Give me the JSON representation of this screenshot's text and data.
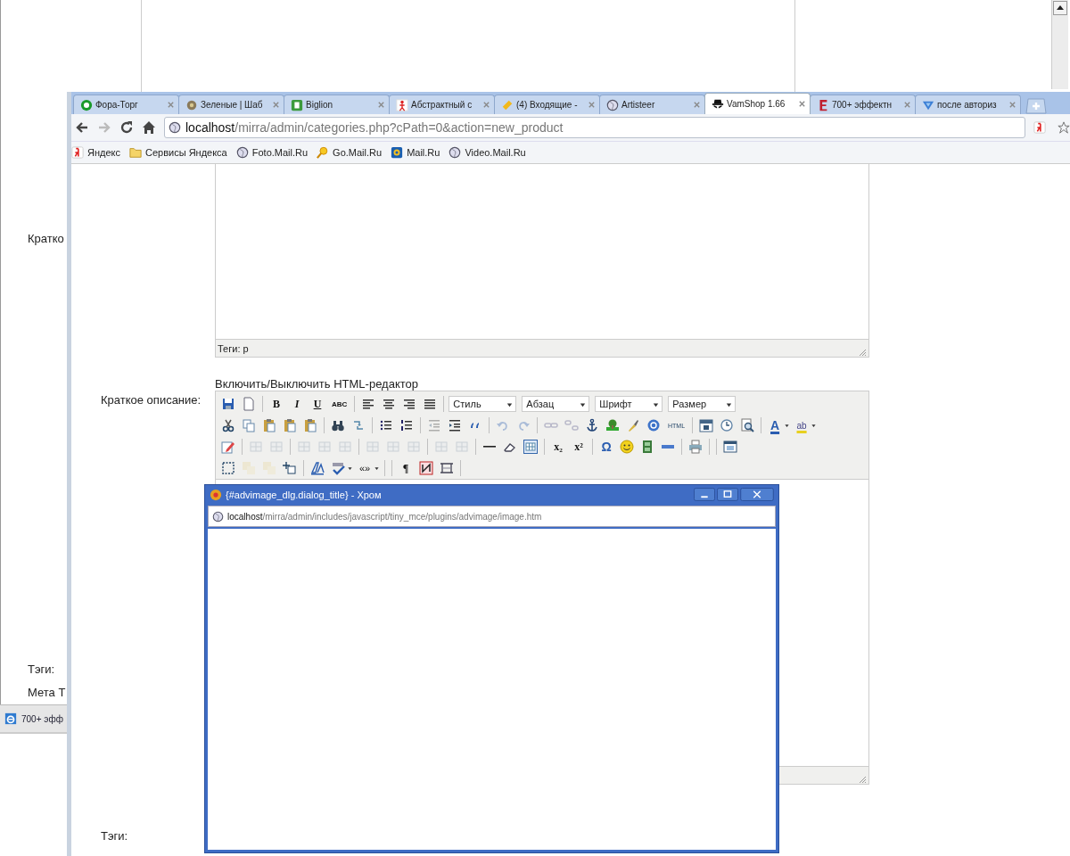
{
  "desktop_page": {
    "labels": [
      "Кратко",
      "Тэги:",
      "Мета Т"
    ]
  },
  "taskbar": {
    "items": [
      {
        "label": "700+ эфф",
        "kind": "ie"
      }
    ]
  },
  "browser": {
    "tabs": [
      {
        "label": "Фора-Торг",
        "kind": "fora",
        "selected": false
      },
      {
        "label": "Зеленые | Шаб",
        "kind": "leaf",
        "selected": false
      },
      {
        "label": "Biglion",
        "kind": "square",
        "selected": false
      },
      {
        "label": "Абстрактный с",
        "kind": "figure",
        "selected": false
      },
      {
        "label": "(4) Входящие -",
        "kind": "mail",
        "selected": false
      },
      {
        "label": "Artisteer",
        "kind": "globe",
        "selected": false
      },
      {
        "label": "VamShop 1.66",
        "kind": "hat",
        "selected": true
      },
      {
        "label": "700+ эффектн",
        "kind": "letter",
        "selected": false
      },
      {
        "label": "после авториз",
        "kind": "triangle",
        "selected": false
      }
    ],
    "address": {
      "host": "localhost",
      "path": "/mirra/admin/categories.php?cPath=0&action=new_product"
    },
    "bookmarks": [
      {
        "label": "Яндекс",
        "kind": "logo"
      },
      {
        "label": "Сервисы Яндекса",
        "kind": "folder"
      },
      {
        "label": "Foto.Mail.Ru",
        "kind": "globe"
      },
      {
        "label": "Go.Mail.Ru",
        "kind": "magnifier"
      },
      {
        "label": "Mail.Ru",
        "kind": "mail"
      },
      {
        "label": "Video.Mail.Ru",
        "kind": "globe"
      }
    ],
    "page": {
      "editor_status": "Теги: p",
      "toggle_link": "Включить/Выключить HTML-редактор",
      "field_label": "Краткое описание:",
      "tags_label": "Тэги:",
      "toolbar": [
        [
          {
            "kind": "save",
            "disabled": false
          },
          {
            "kind": "new",
            "disabled": false
          },
          {
            "kind": "sep"
          },
          {
            "kind": "bold",
            "label": "B",
            "disabled": false
          },
          {
            "kind": "italic",
            "label": "I",
            "disabled": false
          },
          {
            "kind": "underline",
            "label": "U",
            "disabled": false
          },
          {
            "kind": "strike",
            "label": "ABC",
            "disabled": false
          },
          {
            "kind": "sep"
          },
          {
            "kind": "alignleft",
            "disabled": false
          },
          {
            "kind": "aligncenter",
            "disabled": false
          },
          {
            "kind": "alignright",
            "disabled": false
          },
          {
            "kind": "justify",
            "disabled": false
          },
          {
            "kind": "sep"
          },
          {
            "kind": "select",
            "label": "Стиль"
          },
          {
            "kind": "select",
            "label": "Абзац"
          },
          {
            "kind": "select",
            "label": "Шрифт"
          },
          {
            "kind": "select",
            "label": "Размер"
          }
        ],
        [
          {
            "kind": "cut",
            "disabled": false
          },
          {
            "kind": "copy",
            "disabled": false
          },
          {
            "kind": "paste",
            "disabled": false
          },
          {
            "kind": "paste",
            "disabled": false
          },
          {
            "kind": "paste",
            "disabled": false
          },
          {
            "kind": "sep"
          },
          {
            "kind": "find",
            "disabled": false
          },
          {
            "kind": "replace",
            "disabled": false
          },
          {
            "kind": "sep"
          },
          {
            "kind": "bullist",
            "disabled": false
          },
          {
            "kind": "numlist",
            "disabled": false
          },
          {
            "kind": "sep"
          },
          {
            "kind": "outdent",
            "disabled": true
          },
          {
            "kind": "indent",
            "disabled": false
          },
          {
            "kind": "quote",
            "disabled": false
          },
          {
            "kind": "sep"
          },
          {
            "kind": "undo",
            "disabled": true
          },
          {
            "kind": "redo",
            "disabled": true
          },
          {
            "kind": "sep"
          },
          {
            "kind": "link",
            "disabled": true
          },
          {
            "kind": "unlink",
            "disabled": true
          },
          {
            "kind": "anchor",
            "disabled": false
          },
          {
            "kind": "image",
            "disabled": false
          },
          {
            "kind": "brush",
            "disabled": false
          },
          {
            "kind": "help",
            "disabled": false
          },
          {
            "kind": "html",
            "label": "HTML",
            "disabled": false
          },
          {
            "kind": "sep"
          },
          {
            "kind": "calendar",
            "disabled": false
          },
          {
            "kind": "clock",
            "disabled": false
          },
          {
            "kind": "preview",
            "disabled": false
          },
          {
            "kind": "sep"
          },
          {
            "kind": "forecolor",
            "label": "A",
            "disabled": false
          },
          {
            "kind": "caret"
          },
          {
            "kind": "backcolor",
            "label": "ab",
            "disabled": false
          },
          {
            "kind": "caret"
          }
        ],
        [
          {
            "kind": "pencil",
            "disabled": false
          },
          {
            "kind": "sep"
          },
          {
            "kind": "tableop",
            "disabled": true
          },
          {
            "kind": "tableop",
            "disabled": true
          },
          {
            "kind": "sep"
          },
          {
            "kind": "tableop",
            "disabled": true
          },
          {
            "kind": "tableop",
            "disabled": true
          },
          {
            "kind": "tableop",
            "disabled": true
          },
          {
            "kind": "sep"
          },
          {
            "kind": "tableop",
            "disabled": true
          },
          {
            "kind": "tableop",
            "disabled": true
          },
          {
            "kind": "tableop",
            "disabled": true
          },
          {
            "kind": "sep"
          },
          {
            "kind": "tableop",
            "disabled": true
          },
          {
            "kind": "tableop",
            "disabled": true
          },
          {
            "kind": "sep"
          },
          {
            "kind": "hr",
            "disabled": false
          },
          {
            "kind": "eraser",
            "disabled": false
          },
          {
            "kind": "table",
            "disabled": false
          },
          {
            "kind": "sep"
          },
          {
            "kind": "sub",
            "label": "x₂",
            "disabled": false
          },
          {
            "kind": "sup",
            "label": "x²",
            "disabled": false
          },
          {
            "kind": "sep"
          },
          {
            "kind": "omega",
            "label": "Ω",
            "disabled": false
          },
          {
            "kind": "smiley",
            "disabled": false
          },
          {
            "kind": "film",
            "disabled": false
          },
          {
            "kind": "bar",
            "disabled": false
          },
          {
            "kind": "sep"
          },
          {
            "kind": "print",
            "disabled": false
          },
          {
            "kind": "sep"
          },
          {
            "kind": "sep"
          },
          {
            "kind": "window",
            "disabled": false
          }
        ],
        [
          {
            "kind": "dashed",
            "disabled": false
          },
          {
            "kind": "layer",
            "disabled": true
          },
          {
            "kind": "layer",
            "disabled": true
          },
          {
            "kind": "absolute",
            "disabled": false
          },
          {
            "kind": "sep"
          },
          {
            "kind": "styleprops",
            "disabled": false
          },
          {
            "kind": "spell",
            "disabled": false
          },
          {
            "kind": "caret"
          },
          {
            "kind": "quotes",
            "label": "«»",
            "disabled": false
          },
          {
            "kind": "caret"
          },
          {
            "kind": "sep"
          },
          {
            "kind": "sep"
          },
          {
            "kind": "para",
            "label": "¶",
            "disabled": false
          },
          {
            "kind": "pagebreak",
            "disabled": false
          },
          {
            "kind": "nonbreak",
            "disabled": false
          },
          {
            "kind": "sep"
          }
        ]
      ]
    }
  },
  "popup": {
    "title": "{#advimage_dlg.dialog_title} - Хром",
    "address": {
      "host": "localhost",
      "path": "/mirra/admin/includes/javascript/tiny_mce/plugins/advimage/image.htm"
    }
  }
}
